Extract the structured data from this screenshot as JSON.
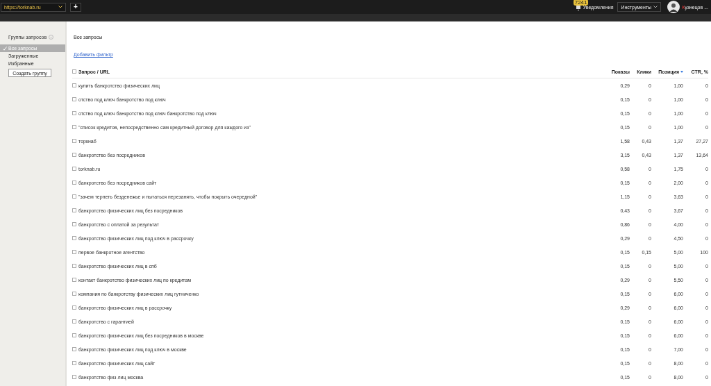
{
  "topbar": {
    "site": "https://torknab.ru",
    "add_button": "+",
    "notifications": {
      "count": "7241",
      "label": "Уведомления"
    },
    "tools": "Инструменты",
    "user": "Кузнецов ..."
  },
  "sidebar": {
    "title": "Группы запросов",
    "items": [
      {
        "label": "Все запросы",
        "selected": true
      },
      {
        "label": "Загруженные",
        "selected": false
      },
      {
        "label": "Избранные",
        "selected": false
      }
    ],
    "create_button": "Создать группу"
  },
  "main": {
    "title": "Все запросы",
    "add_filter": "Добавить фильтр"
  },
  "table": {
    "select_all": {
      "checked": false
    },
    "columns": [
      {
        "label": "Запрос / URL",
        "sorted": false
      },
      {
        "label": "Показы",
        "sorted": false
      },
      {
        "label": "Клики",
        "sorted": false
      },
      {
        "label": "Позиция",
        "sorted": true
      },
      {
        "label": "CTR, %",
        "sorted": false
      }
    ],
    "rows": [
      {
        "checked": false,
        "cells": [
          "купить банкротство физических лиц",
          "0,29",
          "0",
          "1,00",
          "0"
        ]
      },
      {
        "checked": false,
        "cells": [
          "отство под ключ банкротство под ключ",
          "0,15",
          "0",
          "1,00",
          "0"
        ]
      },
      {
        "checked": false,
        "cells": [
          "отство под ключ банкротство под ключ банкротство под ключ",
          "0,15",
          "0",
          "1,00",
          "0"
        ]
      },
      {
        "checked": false,
        "cells": [
          "\"список кредитов, непосредственно сам кредитный договор для каждого из\"",
          "0,15",
          "0",
          "1,00",
          "0"
        ]
      },
      {
        "checked": false,
        "cells": [
          "торкнаб",
          "1,58",
          "0,43",
          "1,37",
          "27,27"
        ]
      },
      {
        "checked": false,
        "cells": [
          "банкротство без посредников",
          "3,15",
          "0,43",
          "1,37",
          "13,64"
        ]
      },
      {
        "checked": false,
        "cells": [
          "torknab.ru",
          "0,58",
          "0",
          "1,75",
          "0"
        ]
      },
      {
        "checked": false,
        "cells": [
          "банкротство без посредников сайт",
          "0,15",
          "0",
          "2,00",
          "0"
        ]
      },
      {
        "checked": false,
        "cells": [
          "\"зачем терпеть безденежье и пытаться перезанять, чтобы покрыть очередной\"",
          "1,15",
          "0",
          "3,63",
          "0"
        ]
      },
      {
        "checked": false,
        "cells": [
          "банкротство физических лиц без посредников",
          "0,43",
          "0",
          "3,67",
          "0"
        ]
      },
      {
        "checked": false,
        "cells": [
          "банкротство с оплатой за результат",
          "0,86",
          "0",
          "4,00",
          "0"
        ]
      },
      {
        "checked": false,
        "cells": [
          "банкротство физических лиц под ключ в рассрочку",
          "0,29",
          "0",
          "4,50",
          "0"
        ]
      },
      {
        "checked": false,
        "cells": [
          "первое банкротное агентство",
          "0,15",
          "0,15",
          "5,00",
          "100"
        ]
      },
      {
        "checked": false,
        "cells": [
          "банкротство физических лиц в спб",
          "0,15",
          "0",
          "5,00",
          "0"
        ]
      },
      {
        "checked": false,
        "cells": [
          "контакт банкротство физических лиц по кредитам",
          "0,29",
          "0",
          "5,50",
          "0"
        ]
      },
      {
        "checked": false,
        "cells": [
          "компания по банкротству физических лиц гутниченко",
          "0,15",
          "0",
          "6,00",
          "0"
        ]
      },
      {
        "checked": false,
        "cells": [
          "банкротство физических лиц в рассрочку",
          "0,29",
          "0",
          "6,00",
          "0"
        ]
      },
      {
        "checked": false,
        "cells": [
          "банкротство с гарантией",
          "0,15",
          "0",
          "6,00",
          "0"
        ]
      },
      {
        "checked": false,
        "cells": [
          "банкротство физических лиц без посредников в москве",
          "0,15",
          "0",
          "6,00",
          "0"
        ]
      },
      {
        "checked": false,
        "cells": [
          "банкротство физических лиц под ключ в москве",
          "0,15",
          "0",
          "7,00",
          "0"
        ]
      },
      {
        "checked": false,
        "cells": [
          "банкротство физических лиц сайт",
          "0,15",
          "0",
          "8,00",
          "0"
        ]
      },
      {
        "checked": false,
        "cells": [
          "банкротство физ лиц москва",
          "0,15",
          "0",
          "8,00",
          "0"
        ]
      }
    ]
  }
}
